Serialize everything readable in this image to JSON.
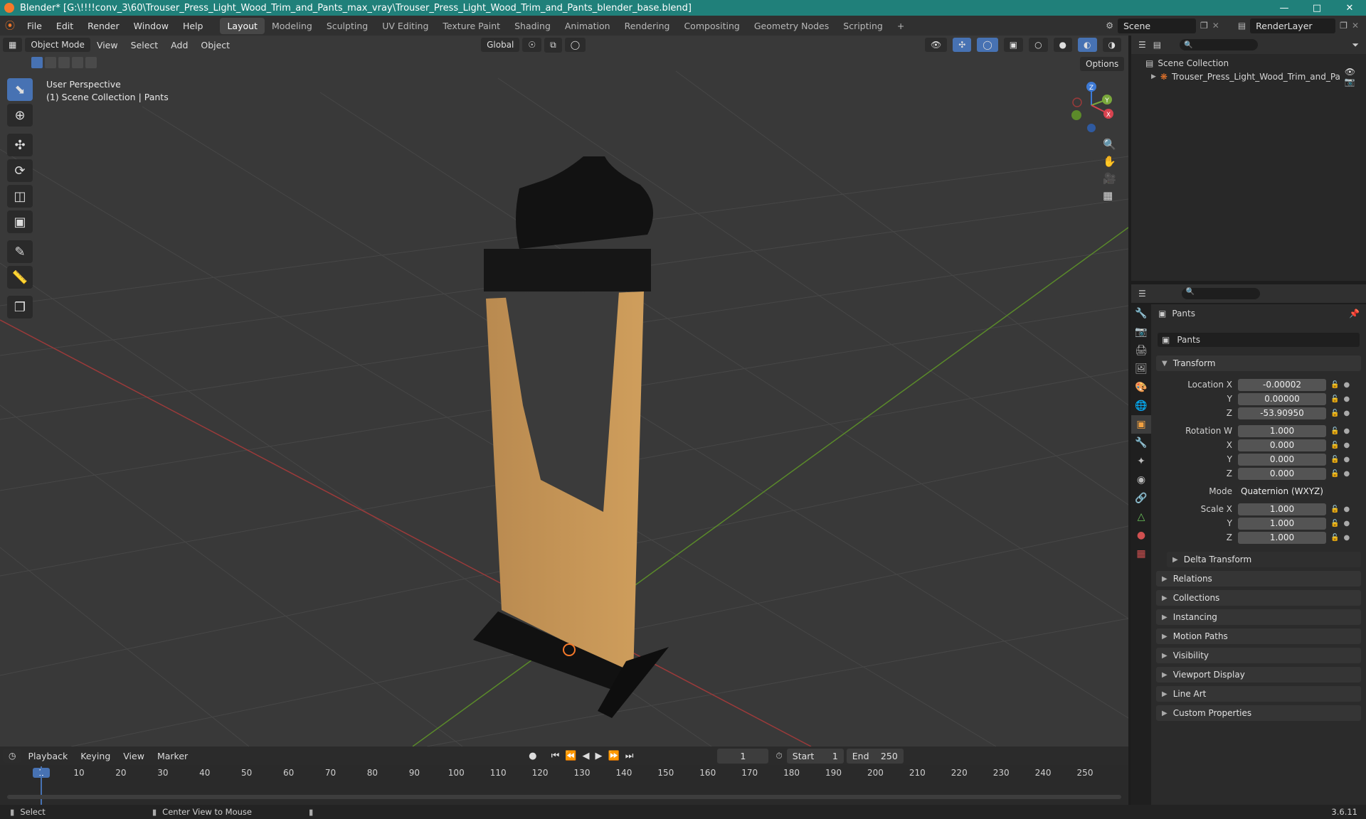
{
  "window": {
    "title": "Blender* [G:\\!!!!conv_3\\60\\Trouser_Press_Light_Wood_Trim_and_Pants_max_vray\\Trouser_Press_Light_Wood_Trim_and_Pants_blender_base.blend]"
  },
  "menu": [
    "File",
    "Edit",
    "Render",
    "Window",
    "Help"
  ],
  "workspaces": [
    {
      "label": "Layout",
      "active": true
    },
    {
      "label": "Modeling"
    },
    {
      "label": "Sculpting"
    },
    {
      "label": "UV Editing"
    },
    {
      "label": "Texture Paint"
    },
    {
      "label": "Shading"
    },
    {
      "label": "Animation"
    },
    {
      "label": "Rendering"
    },
    {
      "label": "Compositing"
    },
    {
      "label": "Geometry Nodes"
    },
    {
      "label": "Scripting"
    }
  ],
  "scene": {
    "name": "Scene",
    "render_layer": "RenderLayer"
  },
  "viewport": {
    "mode": "Object Mode",
    "menus": [
      "View",
      "Select",
      "Add",
      "Object"
    ],
    "transform_orientation": "Global",
    "options_label": "Options",
    "overlay_line1": "User Perspective",
    "overlay_line2": "(1) Scene Collection | Pants",
    "gizmo": {
      "x": "X",
      "y": "Y",
      "z": "Z"
    }
  },
  "outliner": {
    "root": "Scene Collection",
    "items": [
      {
        "label": "Trouser_Press_Light_Wood_Trim_and_Pa"
      }
    ]
  },
  "properties": {
    "object_name": "Pants",
    "data_name": "Pants",
    "transform_title": "Transform",
    "location": {
      "label": "Location X",
      "x": "-0.00002",
      "y": "0.00000",
      "z": "-53.90950"
    },
    "rotation": {
      "label": "Rotation W",
      "w": "1.000",
      "x": "0.000",
      "y": "0.000",
      "z": "0.000"
    },
    "mode_label": "Mode",
    "mode_value": "Quaternion (WXYZ)",
    "scale": {
      "label": "Scale X",
      "x": "1.000",
      "y": "1.000",
      "z": "1.000"
    },
    "axis_y": "Y",
    "axis_z": "Z",
    "axis_x": "X",
    "delta": "Delta Transform",
    "panels": [
      "Relations",
      "Collections",
      "Instancing",
      "Motion Paths",
      "Visibility",
      "Viewport Display",
      "Line Art",
      "Custom Properties"
    ]
  },
  "timeline": {
    "menus": [
      "Playback",
      "Keying",
      "View",
      "Marker"
    ],
    "current_frame": "1",
    "start_label": "Start",
    "start": "1",
    "end_label": "End",
    "end": "250",
    "ticks": [
      "1",
      "10",
      "20",
      "30",
      "40",
      "50",
      "60",
      "70",
      "80",
      "90",
      "100",
      "110",
      "120",
      "130",
      "140",
      "150",
      "160",
      "170",
      "180",
      "190",
      "200",
      "210",
      "220",
      "230",
      "240",
      "250"
    ]
  },
  "status": {
    "select": "Select",
    "center": "Center View to Mouse",
    "version": "3.6.11"
  },
  "colors": {
    "accent": "#4772b3",
    "titlebar": "#20807a",
    "active_object": "#f5792a"
  }
}
